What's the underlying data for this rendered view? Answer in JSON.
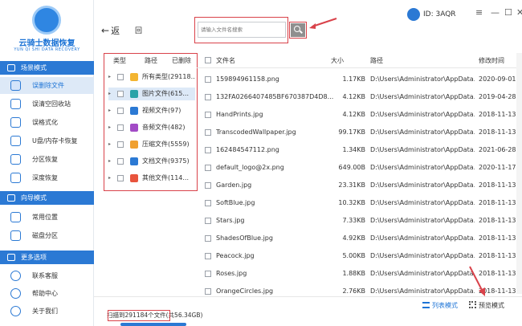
{
  "app": {
    "logo_title": "云骑士数据恢复",
    "logo_subtitle": "YUN QI SHI DATA RECOVERY",
    "id_label": "ID: 3AQR",
    "window_controls": [
      "≡",
      "—",
      "☐",
      "✕"
    ]
  },
  "sidebar": {
    "section1": "场景模式",
    "items1": [
      "误删除文件",
      "误清空回收站",
      "误格式化",
      "U盘/内存卡恢复",
      "分区恢复",
      "深度恢复"
    ],
    "section2": "向导模式",
    "items2": [
      "常用位置",
      "磁盘分区"
    ],
    "section3": "更多选项",
    "items3": [
      "联系客服",
      "帮助中心",
      "关于我们"
    ]
  },
  "toolbar": {
    "back_label": "返",
    "refresh_label": "回",
    "search_placeholder": "请输入文件名搜索"
  },
  "tree": {
    "headers": [
      "类型",
      "路径",
      "已删除"
    ],
    "rows": [
      {
        "label": "所有类型(29118...",
        "icon": "folder-icon",
        "color": "#f3b531"
      },
      {
        "label": "图片文件(615...",
        "icon": "image-icon",
        "color": "#2aa3a8"
      },
      {
        "label": "视频文件(97)",
        "icon": "video-icon",
        "color": "#2b79d4"
      },
      {
        "label": "音频文件(482)",
        "icon": "audio-icon",
        "color": "#a24bc6"
      },
      {
        "label": "压缩文件(5559)",
        "icon": "archive-icon",
        "color": "#f0a030"
      },
      {
        "label": "文档文件(9375)",
        "icon": "document-icon",
        "color": "#2b79d4"
      },
      {
        "label": "其他文件(114...",
        "icon": "other-icon",
        "color": "#e8543d"
      }
    ]
  },
  "grid": {
    "headers": [
      "文件名",
      "大小",
      "路径",
      "修改时间"
    ],
    "rows": [
      [
        "159894961158.png",
        "1.17KB",
        "D:\\Users\\Administrator\\AppData...",
        "2020-09-01"
      ],
      [
        "132FA0266407485BF670387D4D8...",
        "4.12KB",
        "D:\\Users\\Administrator\\AppData...",
        "2019-04-28"
      ],
      [
        "HandPrints.jpg",
        "4.12KB",
        "D:\\Users\\Administrator\\AppData...",
        "2018-11-13"
      ],
      [
        "TranscodedWallpaper.jpg",
        "99.17KB",
        "D:\\Users\\Administrator\\AppData...",
        "2018-11-13"
      ],
      [
        "162484547112.png",
        "1.34KB",
        "D:\\Users\\Administrator\\AppData...",
        "2021-06-28"
      ],
      [
        "default_logo@2x.png",
        "649.00B",
        "D:\\Users\\Administrator\\AppData...",
        "2020-11-17"
      ],
      [
        "Garden.jpg",
        "23.31KB",
        "D:\\Users\\Administrator\\AppData...",
        "2018-11-13"
      ],
      [
        "SoftBlue.jpg",
        "10.32KB",
        "D:\\Users\\Administrator\\AppData...",
        "2018-11-13"
      ],
      [
        "Stars.jpg",
        "7.33KB",
        "D:\\Users\\Administrator\\AppData...",
        "2018-11-13"
      ],
      [
        "ShadesOfBlue.jpg",
        "4.92KB",
        "D:\\Users\\Administrator\\AppData...",
        "2018-11-13"
      ],
      [
        "Peacock.jpg",
        "5.00KB",
        "D:\\Users\\Administrator\\AppData...",
        "2018-11-13"
      ],
      [
        "Roses.jpg",
        "1.88KB",
        "D:\\Users\\Administrator\\AppData...",
        "2018-11-13"
      ],
      [
        "OrangeCircles.jpg",
        "2.76KB",
        "D:\\Users\\Administrator\\AppData...",
        "2018-11-13"
      ]
    ]
  },
  "footer": {
    "status": "扫描到291184个文件(共56.34GB)",
    "list_mode": "列表模式",
    "preview_mode": "预览模式"
  },
  "colors": {
    "accent": "#2b79d4",
    "annotation": "#d9424a"
  }
}
